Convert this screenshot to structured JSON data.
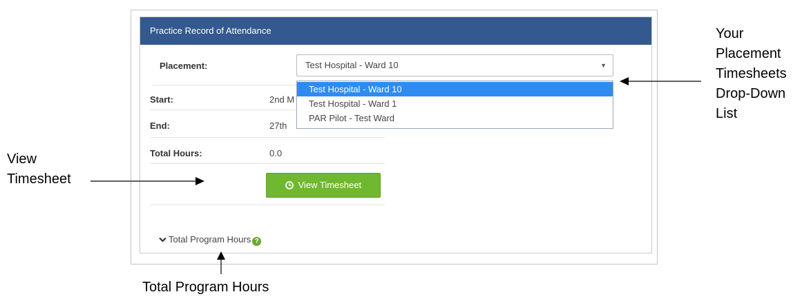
{
  "panel": {
    "title": "Practice Record of Attendance"
  },
  "placement": {
    "label": "Placement:",
    "selected": "Test Hospital - Ward 10",
    "options": [
      "Test Hospital - Ward 10",
      "Test Hospital - Ward 1",
      "PAR Pilot - Test Ward"
    ]
  },
  "fields": {
    "start_label": "Start:",
    "start_value": "2nd M",
    "end_label": "End:",
    "end_value": "27th",
    "total_label": "Total Hours:",
    "total_value": "0.0"
  },
  "buttons": {
    "view_timesheet": "View Timesheet"
  },
  "program_hours": {
    "label": "Total Program Hours",
    "help_glyph": "?"
  },
  "annotations": {
    "dropdown_lines": [
      "Your",
      "Placement",
      "Timesheets",
      "Drop-Down",
      "List"
    ],
    "view_lines": [
      "View",
      "Timesheet"
    ],
    "program_hours": "Total Program Hours"
  },
  "icons": {
    "select_arrow": "caret-down-icon",
    "view_button": "clock-icon",
    "program_hours_toggle": "chevron-down-icon",
    "help": "question-circle-icon"
  },
  "colors": {
    "header": "#34598f",
    "button": "#70b82f",
    "selected_option": "#2e8cf0",
    "help": "#6aa92e"
  }
}
